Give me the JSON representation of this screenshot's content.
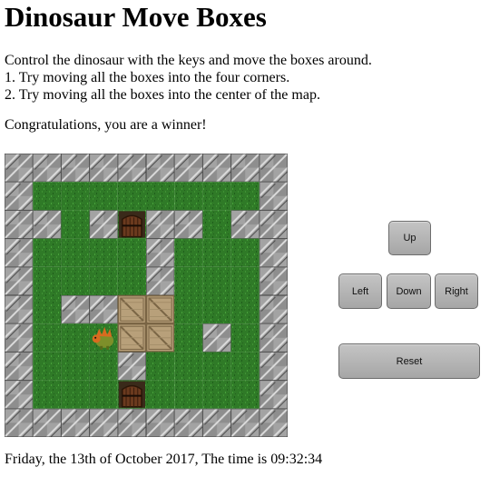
{
  "page": {
    "title": "Dinosaur Move Boxes",
    "instructions": [
      "Control the dinosaur with the keys and move the boxes around.",
      "1. Try moving all the boxes into the four corners.",
      "2. Try moving all the boxes into the center of the map."
    ],
    "status": "Congratulations, you are a winner!",
    "footer": "Friday, the 13th of October 2017, The time is 09:32:34"
  },
  "controls": {
    "up": "Up",
    "left": "Left",
    "down": "Down",
    "right": "Right",
    "reset": "Reset"
  },
  "game": {
    "legend": {
      "W": "stone-wall",
      "G": "grass",
      "D": "door",
      "B": "crate",
      "P": "dinosaur"
    },
    "grid": [
      "WWWWWWWWWW",
      "WGGGGGGGGW",
      "WWGWDWWGWW",
      "WGGGGWGGGW",
      "WGGGGWGGGW",
      "WGWWBBGGGW",
      "WGGPBBGWGW",
      "WGGGWGGGGW",
      "WGGGDGGGGW",
      "WWWWWWWWWW"
    ],
    "colors": {
      "grass": "#2f7a27",
      "grass_dark": "#1f5e1b",
      "wall": "#8e8e8e",
      "wall_light": "#c8c8c8",
      "wall_dark": "#4a4a4a",
      "crate": "#b8a07a",
      "crate_dark": "#7a6545",
      "door": "#6b3a1e",
      "dino": "#d96b1f",
      "dino_body": "#7e8f2a"
    }
  }
}
